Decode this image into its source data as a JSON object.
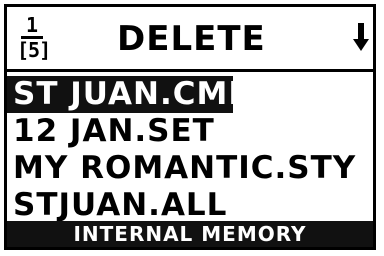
{
  "header": {
    "page_current": "1",
    "page_total": "[5]",
    "title": "DELETE",
    "scroll_icon": "arrow-down-icon"
  },
  "files": [
    {
      "label": "ST JUAN.CMB",
      "selected": true
    },
    {
      "label": "12 JAN.SET",
      "selected": false
    },
    {
      "label": "MY ROMANTIC.STY",
      "selected": false
    },
    {
      "label": "STJUAN.ALL",
      "selected": false
    }
  ],
  "footer": {
    "label": "INTERNAL MEMORY"
  },
  "colors": {
    "foreground": "#000000",
    "background": "#ffffff",
    "highlight": "#111111"
  }
}
